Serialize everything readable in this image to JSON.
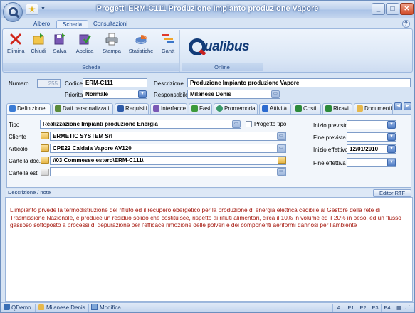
{
  "window": {
    "title": "Progetti ERM-C111 Produzione Impianto produzione Vapore",
    "controls": [
      "_",
      "□",
      "✕"
    ]
  },
  "ribbon_tabs": [
    "Albero",
    "Scheda",
    "Consultazioni"
  ],
  "ribbon": {
    "group_scheda_label": "Scheda",
    "group_online_label": "Online",
    "buttons": [
      "Elimina",
      "Chiudi",
      "Salva",
      "Applica",
      "Stampa",
      "Statistiche",
      "Gantt"
    ],
    "logo_text": "ualibus"
  },
  "header": {
    "numero_label": "Numero",
    "numero_value": "255",
    "codice_label": "Codice",
    "codice_value": "ERM-C111",
    "descrizione_label": "Descrizione",
    "descrizione_value": "Produzione Impianto produzione Vapore",
    "priorita_label": "Priorita",
    "priorita_value": "Normale",
    "responsabile_label": "Responsabile",
    "responsabile_value": "Milanese Denis"
  },
  "tabs": [
    "Definizione",
    "Dati personalizzati",
    "Requisiti",
    "Interfacce",
    "Fasi",
    "Promemoria",
    "Attività",
    "Costi",
    "Ricavi",
    "Documenti"
  ],
  "definizione": {
    "tipo_label": "Tipo",
    "tipo_value": "Realizzazione Impianti produzione Energia",
    "progetto_tipo_label": "Progetto tipo",
    "cliente_label": "Cliente",
    "cliente_value": "ERMETIC SYSTEM Srl",
    "articolo_label": "Articolo",
    "articolo_value": "CPE22 Caldaia Vapore AV120",
    "cartella_doc_label": "Cartella doc.",
    "cartella_doc_value": "\\\\03 Commesse estero\\ERM-C111\\",
    "cartella_est_label": "Cartella est.",
    "cartella_est_value": "",
    "inizio_previsto_label": "Inizio previsto",
    "inizio_previsto_value": "",
    "fine_prevista_label": "Fine prevista",
    "fine_prevista_value": "",
    "inizio_effettivo_label": "Inizio effettivo",
    "inizio_effettivo_value": "12/01/2010",
    "fine_effettiva_label": "Fine effettiva",
    "fine_effettiva_value": ""
  },
  "description": {
    "header_label": "Descrizione / note",
    "editor_button": "Editor RTF",
    "text": "L'impianto prvede la termodistruzione del rifiuto ed il recupero ebergetico per la produzione di energia elettrica cedibile al Gestore della rete di Trasmissione Nazionale, e produce un residuo solido che costituisce, rispetto ai rifiuti alimentari, circa il 10% in volume ed il 20% in peso, ed un flusso gassoso sottoposto a processi di depurazione per l'efficace rimozione delle polveri e dei componenti aeriformi dannosi per l'ambiente"
  },
  "status_bar": {
    "app": "QDemo",
    "user": "Milanese Denis",
    "mode": "Modifica",
    "pages": [
      "A",
      "P1",
      "P2",
      "P3",
      "P4"
    ]
  },
  "colors": {
    "description_text": "#a5180e",
    "title_text": "#ffffff",
    "ribbon_text": "#15428b"
  }
}
